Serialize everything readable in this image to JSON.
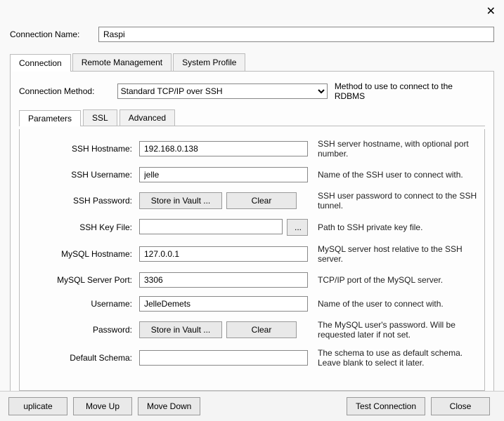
{
  "labels": {
    "connection_name": "Connection Name:",
    "connection_method": "Connection Method:",
    "method_hint": "Method to use to connect to the RDBMS"
  },
  "connection_name": "Raspi",
  "connection_method": "Standard TCP/IP over SSH",
  "main_tabs": {
    "connection": "Connection",
    "remote": "Remote Management",
    "system": "System Profile"
  },
  "sub_tabs": {
    "parameters": "Parameters",
    "ssl": "SSL",
    "advanced": "Advanced"
  },
  "fields": {
    "ssh_hostname": {
      "label": "SSH Hostname:",
      "value": "192.168.0.138",
      "desc": "SSH server hostname, with  optional port number."
    },
    "ssh_username": {
      "label": "SSH Username:",
      "value": "jelle",
      "desc": "Name of the SSH user to connect with."
    },
    "ssh_password": {
      "label": "SSH Password:",
      "desc": "SSH user password to connect to the SSH tunnel."
    },
    "ssh_keyfile": {
      "label": "SSH Key File:",
      "value": "",
      "desc": "Path to SSH private key file."
    },
    "mysql_hostname": {
      "label": "MySQL Hostname:",
      "value": "127.0.0.1",
      "desc": "MySQL server host relative to the SSH server."
    },
    "mysql_port": {
      "label": "MySQL Server Port:",
      "value": "3306",
      "desc": "TCP/IP port of the MySQL server."
    },
    "username": {
      "label": "Username:",
      "value": "JelleDemets",
      "desc": "Name of the user to connect with."
    },
    "password": {
      "label": "Password:",
      "desc": "The MySQL user's password. Will be requested later if not set."
    },
    "default_schema": {
      "label": "Default Schema:",
      "value": "",
      "desc": "The schema to use as default schema. Leave blank to select it later."
    }
  },
  "buttons": {
    "store_vault": "Store in Vault ...",
    "clear": "Clear",
    "browse": "...",
    "duplicate": "uplicate",
    "move_up": "Move Up",
    "move_down": "Move Down",
    "test": "Test Connection",
    "close": "Close"
  }
}
